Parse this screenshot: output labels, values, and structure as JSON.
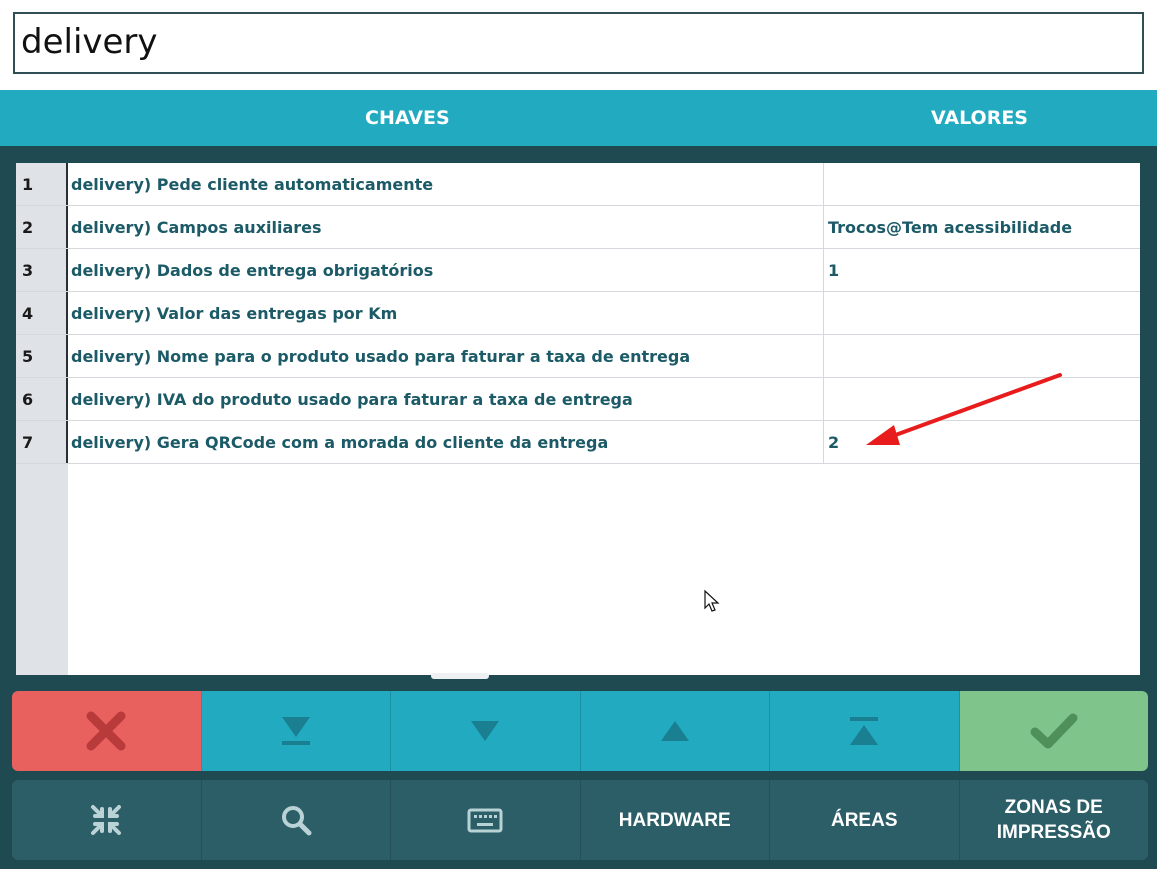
{
  "search": {
    "value": "delivery"
  },
  "header": {
    "keys_label": "CHAVES",
    "values_label": "VALORES"
  },
  "rows": [
    {
      "num": "1",
      "key": "delivery) Pede cliente automaticamente",
      "value": ""
    },
    {
      "num": "2",
      "key": "delivery) Campos auxiliares",
      "value": "Trocos@Tem acessibilidade"
    },
    {
      "num": "3",
      "key": "delivery) Dados de entrega obrigatórios",
      "value": "1"
    },
    {
      "num": "4",
      "key": "delivery) Valor das entregas por Km",
      "value": ""
    },
    {
      "num": "5",
      "key": "delivery) Nome para o produto usado para faturar a taxa de entrega",
      "value": ""
    },
    {
      "num": "6",
      "key": "delivery) IVA do produto usado para faturar a taxa de entrega",
      "value": ""
    },
    {
      "num": "7",
      "key": "delivery) Gera QRCode com a morada do cliente da entrega",
      "value": "2"
    }
  ],
  "actions": {
    "cancel_icon": "close-icon",
    "last_icon": "move-to-bottom-icon",
    "down_icon": "move-down-icon",
    "up_icon": "move-up-icon",
    "first_icon": "move-to-top-icon",
    "confirm_icon": "check-icon"
  },
  "bottom": {
    "collapse_icon": "collapse-icon",
    "search_icon": "search-icon",
    "keyboard_icon": "keyboard-icon",
    "hardware_label": "HARDWARE",
    "areas_label": "ÁREAS",
    "zones_label_line1": "ZONAS DE",
    "zones_label_line2": "IMPRESSÃO"
  },
  "colors": {
    "header": "#21aac0",
    "cancel": "#e8615f",
    "confirm": "#7fc48b",
    "bottom_bar": "#2c5e68",
    "annotation_arrow": "#e81c1c"
  }
}
